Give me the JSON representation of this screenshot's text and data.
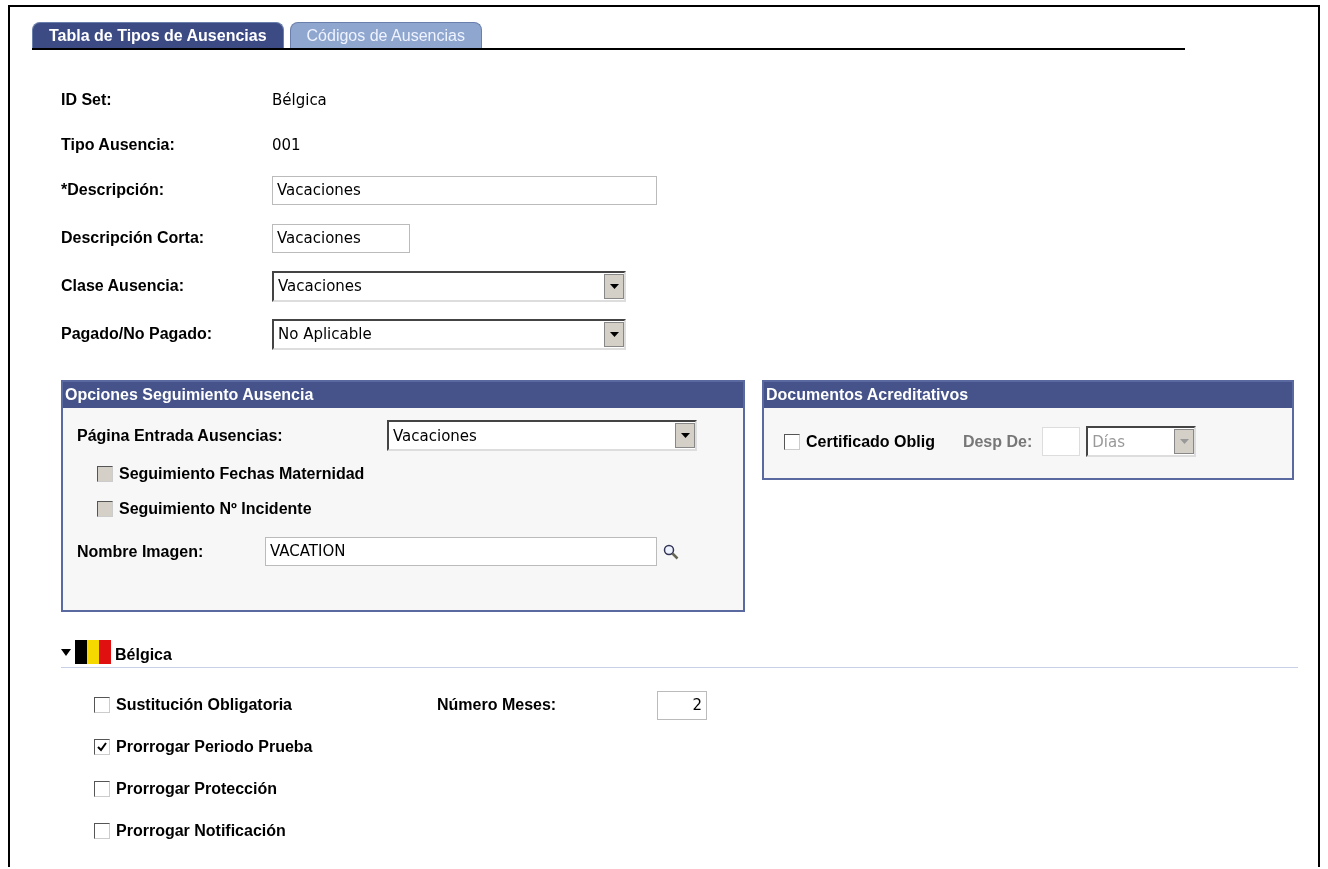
{
  "tabs": [
    {
      "label": "Tabla de Tipos de Ausencias",
      "selected": true
    },
    {
      "label": "Códigos de Ausencias",
      "selected": false
    }
  ],
  "fields": [
    {
      "kind": "text",
      "label": "ID Set:",
      "value": "Bélgica"
    },
    {
      "kind": "text",
      "label": "Tipo Ausencia:",
      "value": "001"
    },
    {
      "kind": "input",
      "label": "*Descripción:",
      "value": "Vacaciones"
    },
    {
      "kind": "short_input",
      "label": "Descripción Corta:",
      "value": "Vacaciones"
    },
    {
      "kind": "select",
      "label": "Clase Ausencia:",
      "value": "Vacaciones"
    },
    {
      "kind": "select",
      "label": "Pagado/No Pagado:",
      "value": "No Aplicable"
    }
  ],
  "tracking": {
    "title": "Opciones Seguimiento Ausencia",
    "page_label": "Página Entrada Ausencias:",
    "page_value": "Vacaciones",
    "checks": [
      {
        "label": "Seguimiento Fechas Maternidad",
        "checked": false,
        "disabled": true
      },
      {
        "label": "Seguimiento Nº Incidente",
        "checked": false,
        "disabled": true
      }
    ],
    "image_label": "Nombre Imagen:",
    "image_value": "VACATION"
  },
  "documents": {
    "title": "Documentos Acreditativos",
    "check": {
      "label": "Certificado Oblig",
      "checked": false,
      "disabled": false
    },
    "after_label": "Desp De:",
    "unit": "Días",
    "disabled": true
  },
  "belgium": {
    "title": "Bélgica",
    "expanded": true,
    "checks": [
      {
        "label": "Sustitución Obligatoria",
        "checked": false,
        "disabled": false
      },
      {
        "label": "Prorrogar Periodo Prueba",
        "checked": true,
        "disabled": false
      },
      {
        "label": "Prorrogar Protección",
        "checked": false,
        "disabled": false
      },
      {
        "label": "Prorrogar Notificación",
        "checked": false,
        "disabled": false
      }
    ],
    "months_label": "Número Meses:",
    "months_value": "2"
  }
}
